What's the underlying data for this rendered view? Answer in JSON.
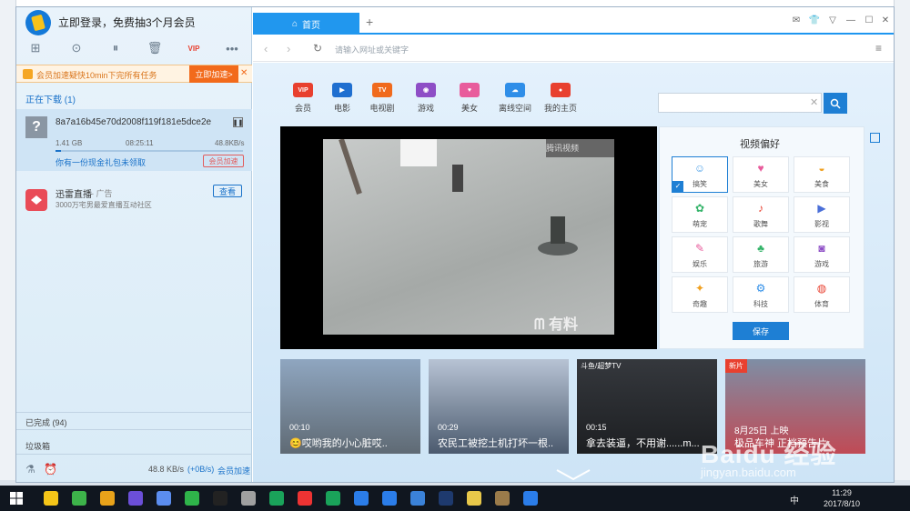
{
  "left_panel": {
    "login_text": "立即登录，免费抽3个月会员",
    "promo": {
      "text": "会员加速疑快10min下完所有任务",
      "button": "立即加速>",
      "close": "✕"
    },
    "downloading_header": "正在下载 (1)",
    "task": {
      "file_name": "8a7a16b45e70d2008f119f181e5dce2e",
      "size": "1.41 GB",
      "time_left": "08:25:11",
      "speed": "48.8KB/s",
      "progress_fraction": 0.03,
      "gift_text": "你有一份现金礼包未领取",
      "accel_button": "会员加速"
    },
    "ad": {
      "name": "迅雷直播",
      "tag": "- 广告",
      "desc": "3000万宅男最爱直播互动社区",
      "button": "查看"
    },
    "completed": "已完成 (94)",
    "trash": "垃圾箱",
    "status": {
      "speed": "48.8 KB/s",
      "speed_delta": "(+0B/s)",
      "vip_link": "会员加速"
    }
  },
  "browser": {
    "tab_label": "首页",
    "new_tab": "+",
    "address_placeholder": "请输入网址或关键字",
    "nav": [
      {
        "label": "会员",
        "icon": "VIP",
        "color": "#e8402f"
      },
      {
        "label": "电影",
        "icon": "▶",
        "color": "#1f6fd0"
      },
      {
        "label": "电视剧",
        "icon": "TV",
        "color": "#f06a1d"
      },
      {
        "label": "游戏",
        "icon": "◉",
        "color": "#8e4ec6"
      },
      {
        "label": "美女",
        "icon": "♥",
        "color": "#e85c9c"
      },
      {
        "label": "离线空间",
        "icon": "☁",
        "color": "#2f8ee8"
      },
      {
        "label": "我的主页",
        "icon": "●",
        "color": "#e8402f"
      }
    ],
    "video": {
      "watermark_top": "腾讯视频",
      "watermark_bottom": "ᗰ 有料"
    },
    "prefs": {
      "title": "视频偏好",
      "items": [
        {
          "label": "搞笑",
          "icon": "☺",
          "color": "#4a9fe8",
          "selected": true
        },
        {
          "label": "美女",
          "icon": "♥",
          "color": "#e85c9c",
          "selected": false
        },
        {
          "label": "美食",
          "icon": "◒",
          "color": "#f0a020",
          "selected": false
        },
        {
          "label": "萌宠",
          "icon": "✿",
          "color": "#35b46a",
          "selected": false
        },
        {
          "label": "歌舞",
          "icon": "♪",
          "color": "#e8402f",
          "selected": false
        },
        {
          "label": "影视",
          "icon": "▶",
          "color": "#4a6fd8",
          "selected": false
        },
        {
          "label": "娱乐",
          "icon": "✎",
          "color": "#e85c9c",
          "selected": false
        },
        {
          "label": "旅游",
          "icon": "♣",
          "color": "#35b46a",
          "selected": false
        },
        {
          "label": "游戏",
          "icon": "◙",
          "color": "#8e4ec6",
          "selected": false
        },
        {
          "label": "奇趣",
          "icon": "✦",
          "color": "#f0a020",
          "selected": false
        },
        {
          "label": "科技",
          "icon": "⚙",
          "color": "#2f8ee8",
          "selected": false
        },
        {
          "label": "体育",
          "icon": "◍",
          "color": "#e8402f",
          "selected": false
        }
      ],
      "save": "保存"
    },
    "thumbs": [
      {
        "duration": "00:10",
        "caption": "😊哎哟我的小心脏哎..",
        "badge": ""
      },
      {
        "duration": "00:29",
        "caption": "农民工被挖土机打坏一根..",
        "badge": ""
      },
      {
        "duration": "00:15",
        "caption": "拿去装逼，不用谢......m...",
        "badge": "斗鱼/超梦TV"
      },
      {
        "duration": "",
        "caption": "极品车神 正档预告片",
        "badge": "新片",
        "date": "8月25日 上映"
      }
    ]
  },
  "taskbar": {
    "time": "11:29",
    "date": "2017/8/10",
    "ime": "中"
  },
  "watermark": {
    "line1": "Baidu 经验",
    "line2": "jingyan.baidu.com"
  }
}
